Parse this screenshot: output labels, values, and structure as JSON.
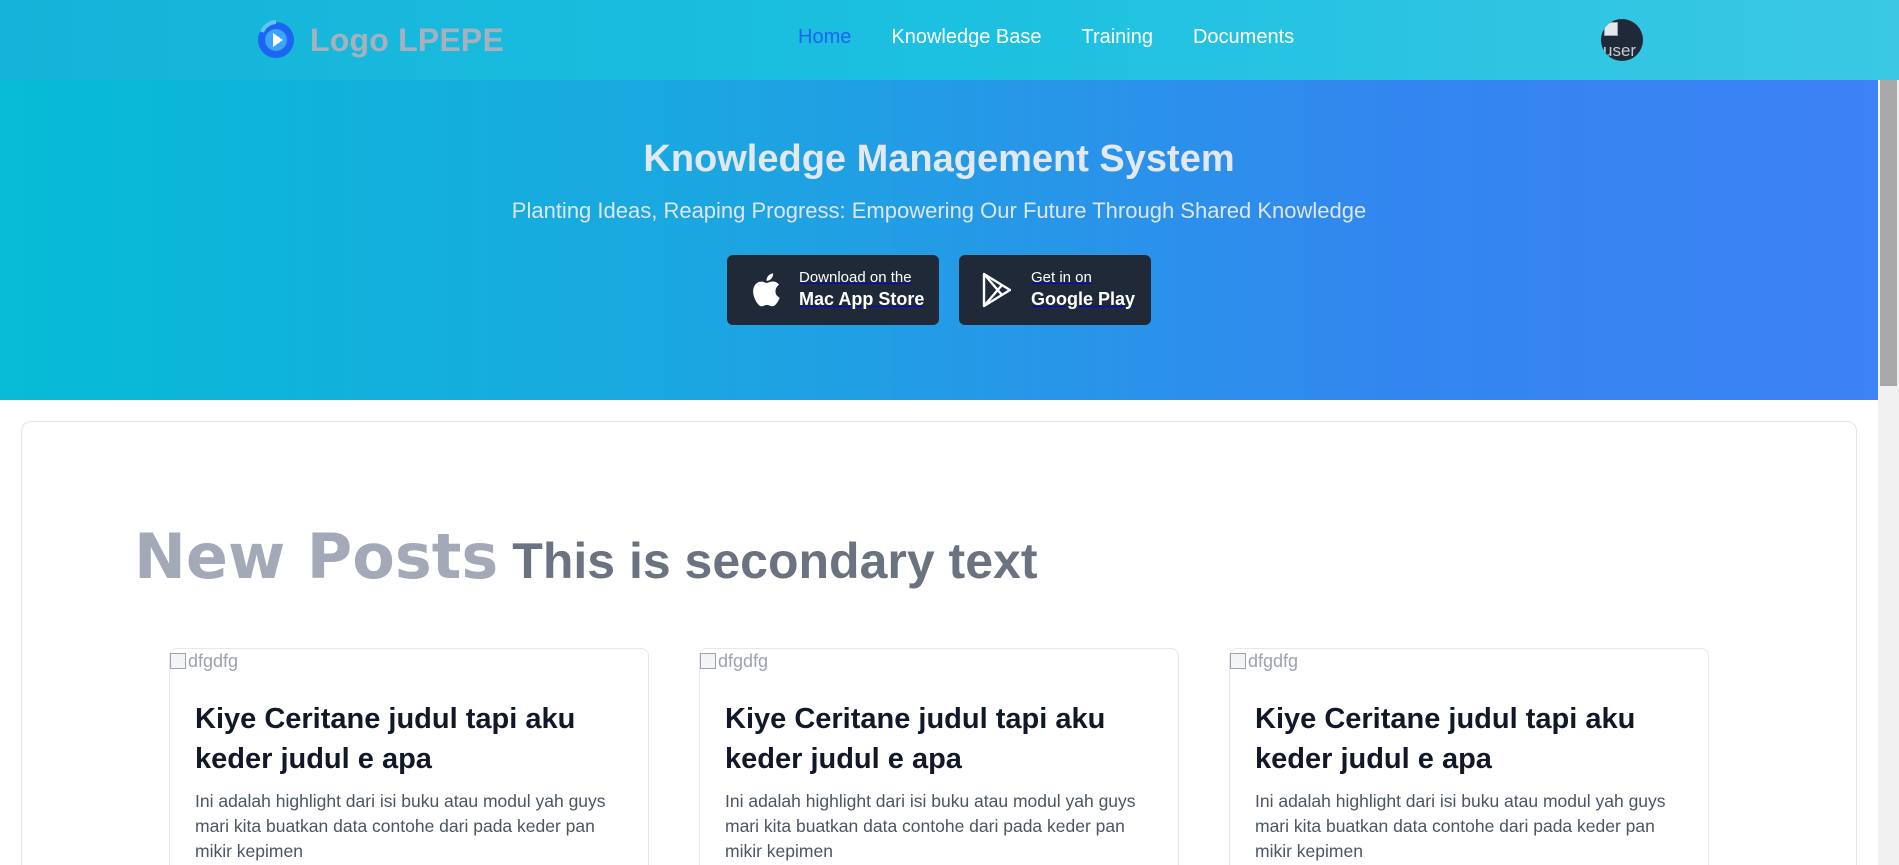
{
  "navbar": {
    "brand_text": "Logo LPEPE",
    "links": [
      {
        "label": "Home",
        "active": true
      },
      {
        "label": "Knowledge Base",
        "active": false
      },
      {
        "label": "Training",
        "active": false
      },
      {
        "label": "Documents",
        "active": false
      }
    ],
    "avatar_alt": "user"
  },
  "hero": {
    "title": "Knowledge Management System",
    "subtitle": "Planting Ideas, Reaping Progress: Empowering Our Future Through Shared Knowledge",
    "apple_button": {
      "small": "Download on the",
      "big": "Mac App Store",
      "icon": "apple-icon"
    },
    "google_button": {
      "small": "Get in on",
      "big": "Google Play",
      "icon": "google-play-icon"
    }
  },
  "section": {
    "title": "New Posts",
    "subtitle": "This is secondary text"
  },
  "posts": [
    {
      "image_alt": "dfgdfg",
      "title": "Kiye Ceritane judul tapi aku keder judul e apa",
      "excerpt": "Ini adalah highlight dari isi buku atau modul yah guys mari kita buatkan data contohe dari pada keder pan mikir kepimen"
    },
    {
      "image_alt": "dfgdfg",
      "title": "Kiye Ceritane judul tapi aku keder judul e apa",
      "excerpt": "Ini adalah highlight dari isi buku atau modul yah guys mari kita buatkan data contohe dari pada keder pan mikir kepimen"
    },
    {
      "image_alt": "dfgdfg",
      "title": "Kiye Ceritane judul tapi aku keder judul e apa",
      "excerpt": "Ini adalah highlight dari isi buku atau modul yah guys mari kita buatkan data contohe dari pada keder pan mikir kepimen"
    }
  ],
  "colors": {
    "nav_active": "#1d64f2",
    "store_button_bg": "#1f2937",
    "hero_gradient_start": "#06bcd6",
    "hero_gradient_end": "#3d82f6"
  }
}
